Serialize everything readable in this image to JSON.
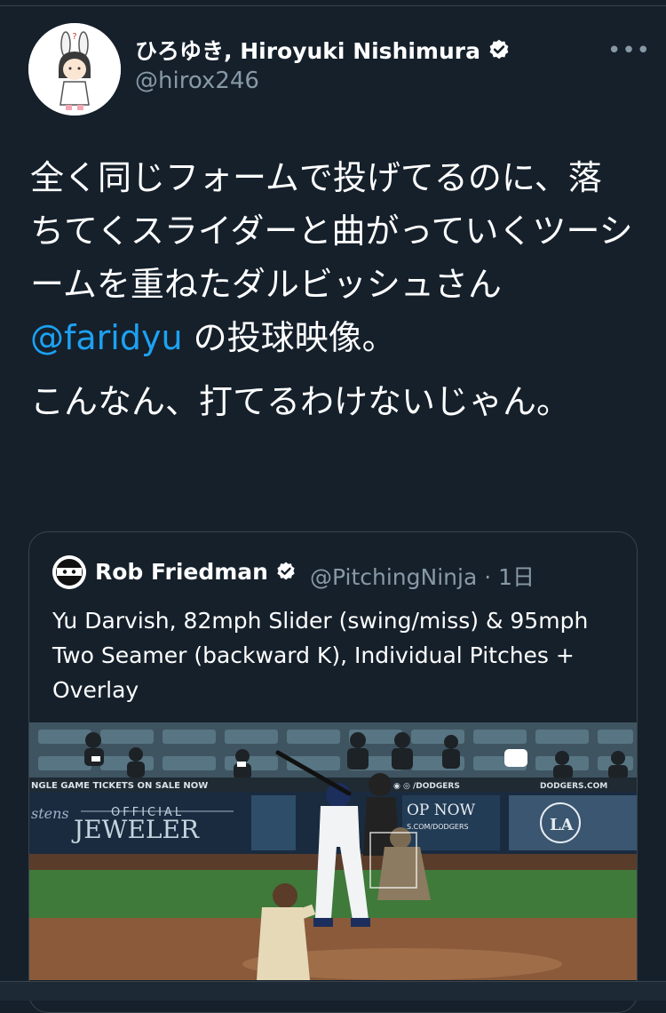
{
  "tweet": {
    "author": {
      "display_name": "ひろゆき, Hiroyuki Nishimura",
      "handle": "@hirox246",
      "verified": true,
      "avatar_icon": "cartoon-avatar-icon"
    },
    "more_label": "•••",
    "body": {
      "para1_pre": "全く同じフォームで投げてるのに、落ちてくスライダーと曲がっていくツーシームを重ねたダルビッシュさん ",
      "mention": "@faridyu",
      "para1_post": " の投球映像。",
      "para2": "こんなん、打てるわけないじゃん。"
    },
    "quote": {
      "author": {
        "display_name": "Rob Friedman",
        "handle_time": "@PitchingNinja · 1日",
        "verified": true,
        "avatar_icon": "ninja-avatar-icon"
      },
      "text": "Yu Darvish, 82mph Slider (swing/miss) & 95mph Two Seamer (backward K), Individual Pitches + Overlay",
      "media": {
        "banner_left": "NGLE GAME TICKETS ON SALE NOW",
        "banner_center": "◉ ◎ /DODGERS",
        "banner_right": "DODGERS.COM",
        "sign_official": "OFFICIAL",
        "sign_jeweler": "JEWELER",
        "sign_stens": "stens",
        "sign_shop": "OP NOW",
        "sign_shop_url": "S.COM/DODGERS",
        "sign_la": "LA"
      }
    }
  },
  "colors": {
    "background": "#15202b",
    "mention": "#1da1f2",
    "secondary_text": "#8899a6",
    "border": "#38444d"
  }
}
